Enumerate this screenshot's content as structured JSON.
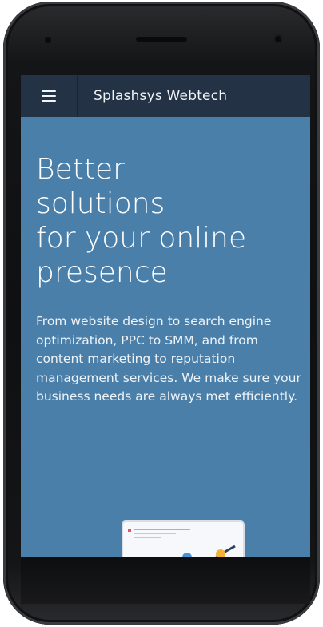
{
  "header": {
    "brand": "Splashsys Webtech",
    "menu_icon": "hamburger-menu-icon"
  },
  "hero": {
    "headline_lines": [
      "Better",
      "solutions",
      "for your online",
      "presence"
    ],
    "description": "From website design to search engine optimization, PPC to SMM, and from content marketing to reputation management services. We make sure your business needs are always met efficiently."
  },
  "colors": {
    "header_bg": "#233244",
    "hero_bg": "#4a7faa",
    "text": "#ffffff"
  }
}
